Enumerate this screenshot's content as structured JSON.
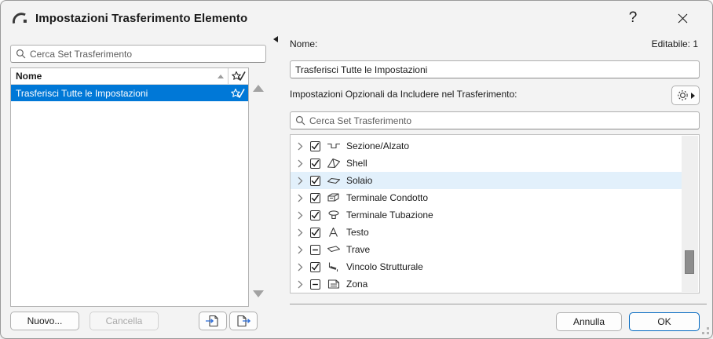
{
  "window": {
    "title": "Impostazioni Trasferimento Elemento",
    "help_label": "?"
  },
  "left_panel": {
    "search": {
      "placeholder": "Cerca Set Trasferimento"
    },
    "list": {
      "header_name": "Nome",
      "items": [
        {
          "label": "Trasferisci Tutte le Impostazioni",
          "selected": true,
          "favorite": true
        }
      ]
    },
    "buttons": {
      "new_label": "Nuovo...",
      "delete_label": "Cancella"
    }
  },
  "right_panel": {
    "name_label": "Nome:",
    "editable_label": "Editabile: 1",
    "name_value": "Trasferisci Tutte le Impostazioni",
    "options_label": "Impostazioni Opzionali da Includere nel Trasferimento:",
    "search": {
      "placeholder": "Cerca Set Trasferimento"
    },
    "tree": {
      "items": [
        {
          "label": "Sezione/Alzato",
          "checked": "checked",
          "icon": "section-elevation-icon"
        },
        {
          "label": "Shell",
          "checked": "checked",
          "icon": "shell-icon"
        },
        {
          "label": "Solaio",
          "checked": "checked",
          "icon": "slab-icon",
          "highlighted": true
        },
        {
          "label": "Terminale Condotto",
          "checked": "checked",
          "icon": "duct-terminal-icon"
        },
        {
          "label": "Terminale Tubazione",
          "checked": "checked",
          "icon": "pipe-terminal-icon"
        },
        {
          "label": "Testo",
          "checked": "checked",
          "icon": "text-icon"
        },
        {
          "label": "Trave",
          "checked": "mixed",
          "icon": "beam-icon"
        },
        {
          "label": "Vincolo Strutturale",
          "checked": "checked",
          "icon": "structural-restraint-icon"
        },
        {
          "label": "Zona",
          "checked": "mixed",
          "icon": "zone-icon"
        }
      ]
    }
  },
  "footer": {
    "cancel_label": "Annulla",
    "ok_label": "OK"
  },
  "colors": {
    "selection_blue": "#0078d7",
    "row_highlight": "#e2f0fb",
    "ok_border_blue": "#0067c0"
  }
}
